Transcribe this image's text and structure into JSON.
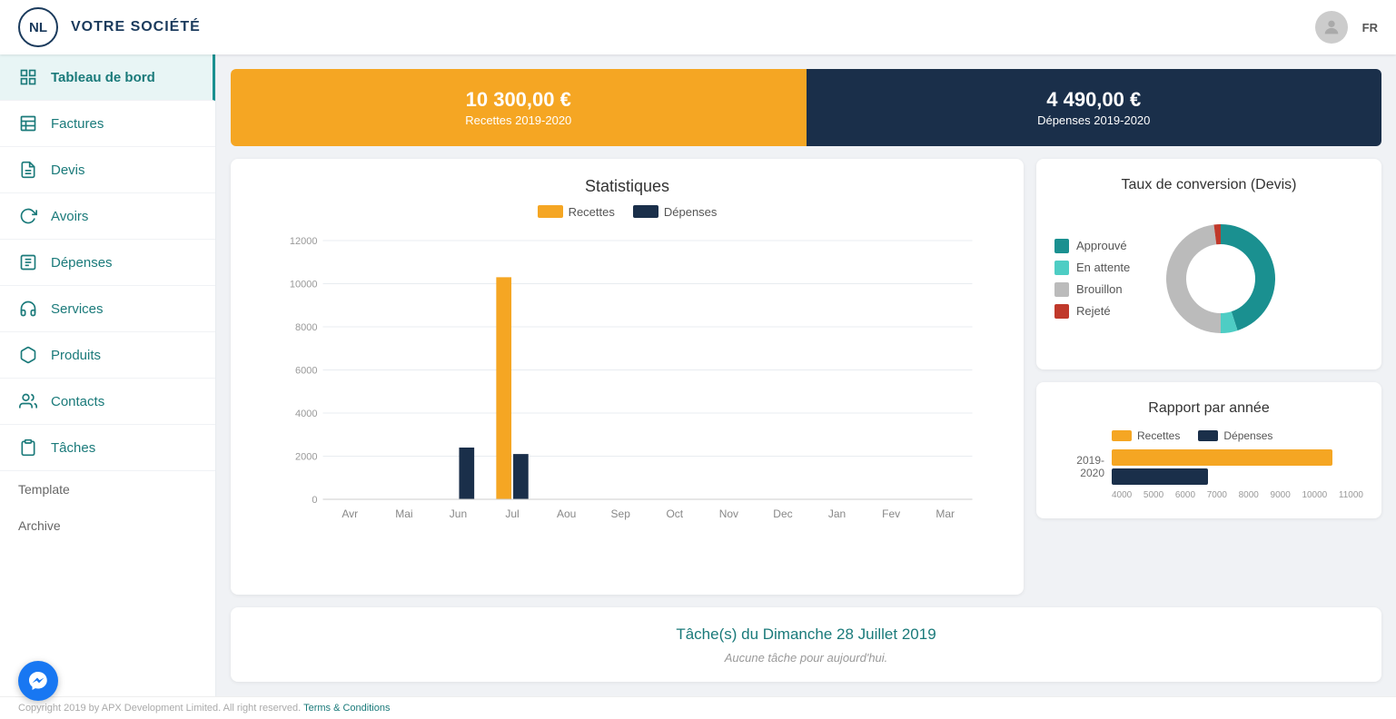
{
  "header": {
    "logo_text": "NL",
    "company_name": "VOTRE SOCIÉTÉ",
    "lang": "FR"
  },
  "sidebar": {
    "items": [
      {
        "id": "tableau",
        "label": "Tableau de bord",
        "icon": "grid",
        "active": true
      },
      {
        "id": "factures",
        "label": "Factures",
        "icon": "building"
      },
      {
        "id": "devis",
        "label": "Devis",
        "icon": "document"
      },
      {
        "id": "avoirs",
        "label": "Avoirs",
        "icon": "refresh"
      },
      {
        "id": "depenses",
        "label": "Dépenses",
        "icon": "document-list"
      },
      {
        "id": "services",
        "label": "Services",
        "icon": "headset"
      },
      {
        "id": "produits",
        "label": "Produits",
        "icon": "box"
      },
      {
        "id": "contacts",
        "label": "Contacts",
        "icon": "people"
      },
      {
        "id": "taches",
        "label": "Tâches",
        "icon": "clipboard"
      }
    ],
    "sections": [
      {
        "id": "template",
        "label": "Template"
      },
      {
        "id": "archive",
        "label": "Archive"
      }
    ]
  },
  "cards": {
    "recettes": {
      "amount": "10 300,00 €",
      "label": "Recettes 2019-2020"
    },
    "depenses": {
      "amount": "4 490,00 €",
      "label": "Dépenses 2019-2020"
    }
  },
  "chart": {
    "title": "Statistiques",
    "legend": {
      "recettes_label": "Recettes",
      "depenses_label": "Dépenses"
    },
    "colors": {
      "recettes": "#f5a623",
      "depenses": "#1a2f4a"
    },
    "months": [
      "Avr",
      "Mai",
      "Jun",
      "Jul",
      "Aou",
      "Sep",
      "Oct",
      "Nov",
      "Dec",
      "Jan",
      "Fev",
      "Mar"
    ],
    "recettes_data": [
      0,
      0,
      0,
      10300,
      0,
      0,
      0,
      0,
      0,
      0,
      0,
      0
    ],
    "depenses_data": [
      0,
      0,
      2400,
      2100,
      0,
      0,
      0,
      0,
      0,
      0,
      0,
      0
    ],
    "y_max": 12000,
    "y_ticks": [
      0,
      2000,
      4000,
      6000,
      8000,
      10000,
      12000
    ]
  },
  "conversion": {
    "title": "Taux de conversion  (Devis)",
    "legend": [
      {
        "label": "Approuvé",
        "color": "#1a9090"
      },
      {
        "label": "En attente",
        "color": "#4ecdc4"
      },
      {
        "label": "Brouillon",
        "color": "#bbb"
      },
      {
        "label": "Rejeté",
        "color": "#c0392b"
      }
    ],
    "donut": {
      "approuve": 45,
      "en_attente": 5,
      "brouillon": 48,
      "rejete": 2
    }
  },
  "rapport": {
    "title": "Rapport par année",
    "legend": {
      "recettes_label": "Recettes",
      "depenses_label": "Dépenses"
    },
    "data": [
      {
        "year": "2019-2020",
        "recettes": 10300,
        "depenses": 4490
      }
    ],
    "x_axis": [
      "4000",
      "5000",
      "6000",
      "7000",
      "8000",
      "9000",
      "10000",
      "11000"
    ],
    "max": 11000
  },
  "tasks": {
    "title": "Tâche(s) du  Dimanche 28 Juillet 2019",
    "empty_label": "Aucune tâche pour aujourd'hui."
  },
  "footer": {
    "copyright": "Copyright 2019 by APX Development Limited. All right reserved.",
    "terms_label": "Terms & Conditions"
  }
}
